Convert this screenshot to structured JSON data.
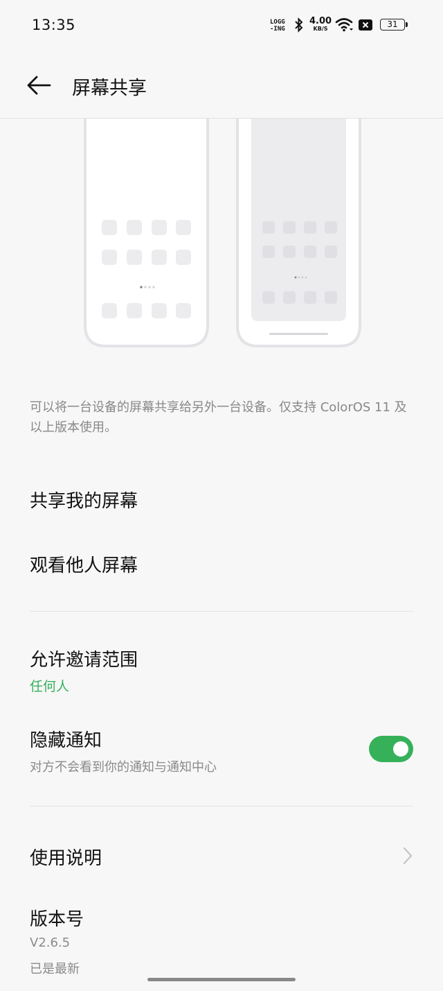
{
  "status_bar": {
    "time": "13:35",
    "logging_line1": "LOGG",
    "logging_line2": "-ING",
    "net_speed_value": "4.00",
    "net_speed_unit": "KB/S",
    "battery": "31",
    "icons": [
      "bluetooth-icon",
      "wifi-icon",
      "no-sim-icon",
      "battery-icon"
    ]
  },
  "header": {
    "title": "屏幕共享",
    "back_icon": "back-arrow-icon"
  },
  "description": "可以将一台设备的屏幕共享给另外一台设备。仅支持 ColorOS 11 及以上版本使用。",
  "actions": {
    "share_my_screen": "共享我的屏幕",
    "view_others_screen": "观看他人屏幕"
  },
  "settings": {
    "invite_scope_label": "允许邀请范围",
    "invite_scope_value": "任何人",
    "hide_notifications_label": "隐藏通知",
    "hide_notifications_desc": "对方不会看到你的通知与通知中心",
    "hide_notifications_on": true
  },
  "info": {
    "usage_label": "使用说明",
    "version_label": "版本号",
    "version_value": "V2.6.5",
    "version_status": "已是最新"
  },
  "colors": {
    "accent_green": "#36b15a",
    "background": "#f7f7f7"
  }
}
